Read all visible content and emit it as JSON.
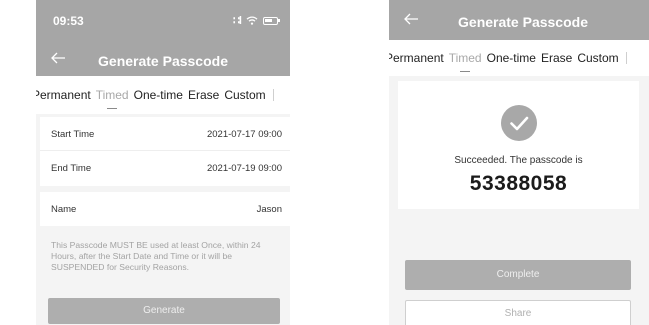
{
  "left_screen": {
    "status_bar": {
      "time": "09:53",
      "signal_icon": "signal-icon",
      "wifi_icon": "wifi-icon",
      "battery_icon": "battery-icon"
    },
    "header": {
      "title": "Generate Passcode",
      "back_icon": "back-arrow-icon"
    },
    "tabs": [
      {
        "label": "Permanent",
        "active": false
      },
      {
        "label": "Timed",
        "active": true
      },
      {
        "label": "One-time",
        "active": false
      },
      {
        "label": "Erase",
        "active": false
      },
      {
        "label": "Custom",
        "active": false
      }
    ],
    "form": {
      "start_time": {
        "label": "Start Time",
        "value": "2021-07-17 09:00"
      },
      "end_time": {
        "label": "End Time",
        "value": "2021-07-19 09:00"
      },
      "name": {
        "label": "Name",
        "value": "Jason"
      }
    },
    "notice": "This Passcode MUST BE used at least Once, within 24 Hours, after the Start Date and Time or it will be SUSPENDED for Security Reasons.",
    "generate_label": "Generate"
  },
  "right_screen": {
    "header": {
      "title": "Generate Passcode",
      "back_icon": "back-arrow-icon"
    },
    "tabs": [
      {
        "label": "Permanent",
        "active": false
      },
      {
        "label": "Timed",
        "active": true
      },
      {
        "label": "One-time",
        "active": false
      },
      {
        "label": "Erase",
        "active": false
      },
      {
        "label": "Custom",
        "active": false
      }
    ],
    "result": {
      "icon": "check-circle-icon",
      "message": "Succeeded. The passcode is",
      "passcode": "53388058"
    },
    "complete_label": "Complete",
    "share_label": "Share"
  },
  "colors": {
    "header": "#a6a6a6",
    "background": "#f4f4f4",
    "card": "#ffffff",
    "button": "#aeaeae",
    "muted_text": "#a3a3a3"
  }
}
